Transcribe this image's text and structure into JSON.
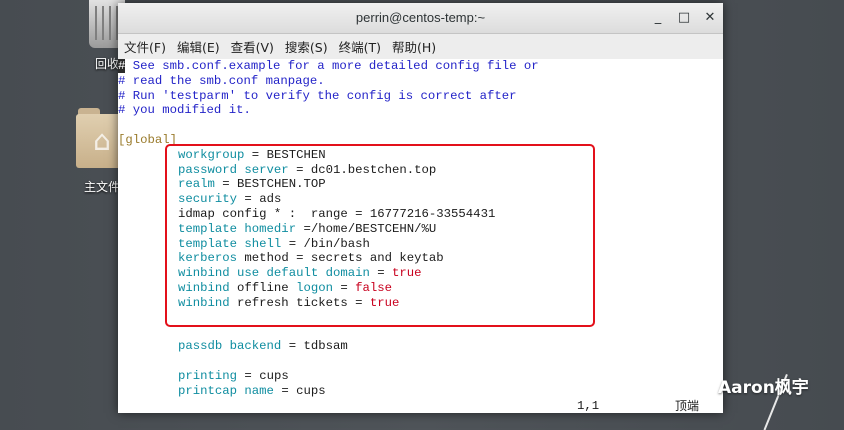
{
  "desktop": {
    "trash_label": "回收",
    "home_label": "主文件"
  },
  "window": {
    "title": "perrin@centos-temp:~",
    "controls": [
      "_",
      "□",
      "✕"
    ],
    "menu": [
      "文件(F)",
      "编辑(E)",
      "查看(V)",
      "搜索(S)",
      "终端(T)",
      "帮助(H)"
    ]
  },
  "terminal": {
    "comments": [
      "# See smb.conf.example for a more detailed config file or",
      "# read the smb.conf manpage.",
      "# Run 'testparm' to verify the config is correct after",
      "# you modified it."
    ],
    "section": "[global]",
    "settings": [
      {
        "key": "workgroup",
        "eq": " = ",
        "value": "BESTCHEN"
      },
      {
        "key": "password server",
        "eq": " = ",
        "value": "dc01.bestchen.top"
      },
      {
        "key": "realm",
        "eq": " = ",
        "value": "BESTCHEN.TOP"
      },
      {
        "key": "security",
        "eq": " = ",
        "value": "ads"
      },
      {
        "key": "idmap config * : range",
        "eq": " = ",
        "value": "16777216-33554431"
      },
      {
        "key": "template homedir",
        "eq": " =",
        "value": "/home/BESTCEHN/%U"
      },
      {
        "key": "template shell",
        "eq": " = ",
        "value": "/bin/bash"
      },
      {
        "key": "kerberos method",
        "eq": " = ",
        "value": "secrets and keytab"
      },
      {
        "key": "winbind use default domain",
        "eq": " = ",
        "value": "true"
      },
      {
        "key": "winbind offline logon",
        "eq": " = ",
        "value": "false"
      },
      {
        "key": "winbind refresh tickets",
        "eq": " = ",
        "value": "true"
      }
    ],
    "extra": [
      {
        "key": "passdb backend",
        "eq": " = ",
        "value": "tdbsam"
      },
      {
        "key": "printing",
        "eq": " = ",
        "value": "cups"
      },
      {
        "key": "printcap name",
        "eq": " = ",
        "value": "cups"
      }
    ],
    "status_position": "1,1",
    "status_scroll": "顶端"
  },
  "watermark": "Aaron枫宇",
  "colors": {
    "comment": "#2323c8",
    "keyword": "#0f8da0",
    "section": "#9a7b2c",
    "boolean": "#c8001e",
    "highlight_box": "#e3101a"
  }
}
